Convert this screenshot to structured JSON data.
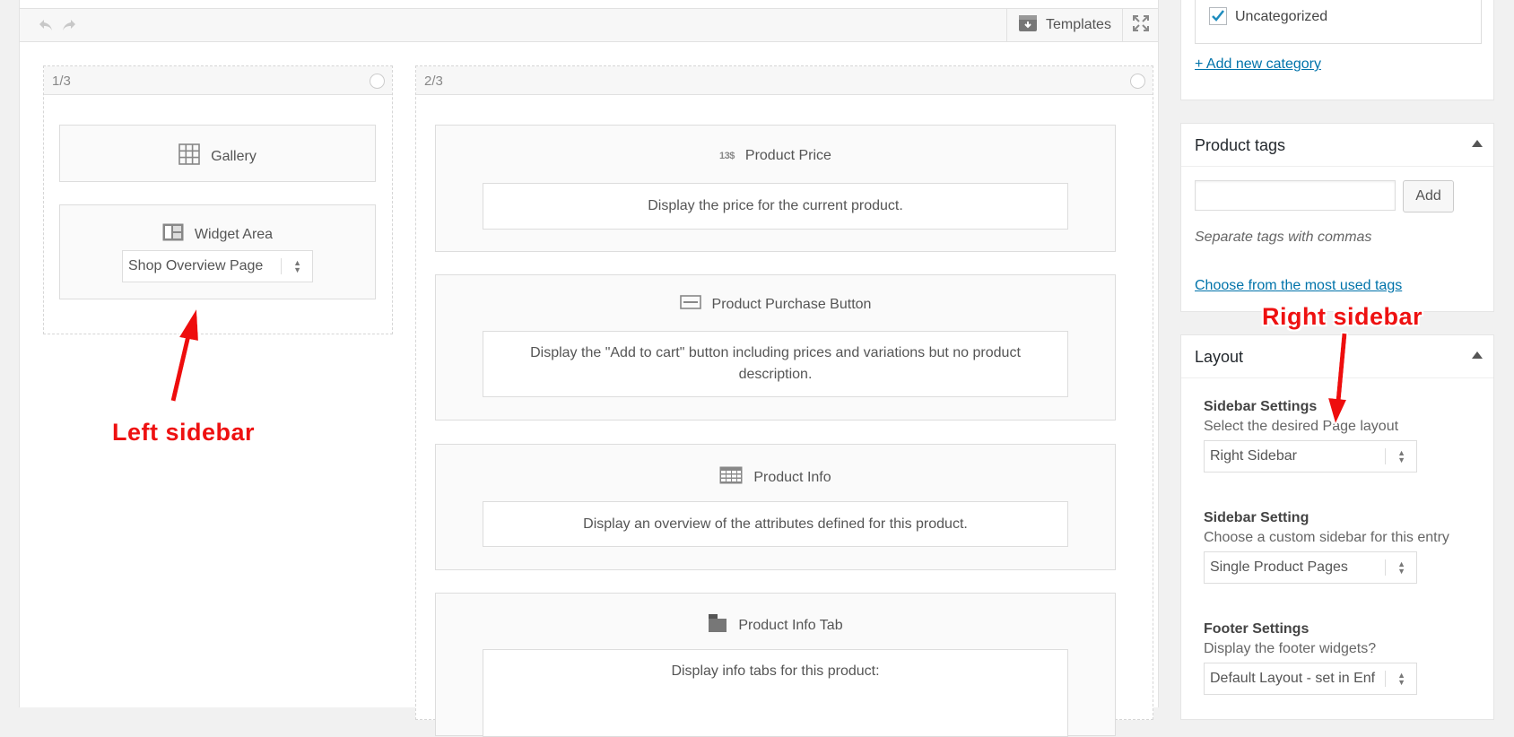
{
  "builder": {
    "toolbar": {
      "undo_icon": "undo-icon",
      "redo_icon": "redo-icon",
      "templates_label": "Templates",
      "templates_icon": "template-box-icon",
      "fullscreen_icon": "fullscreen-icon"
    },
    "left_column": {
      "label": "1/3",
      "elements": [
        {
          "title": "Gallery",
          "icon": "grid-icon"
        },
        {
          "title": "Widget Area",
          "icon": "widget-layout-icon",
          "select_value": "Shop Overview Page"
        }
      ]
    },
    "right_column": {
      "label": "2/3",
      "elements": [
        {
          "title": "Product Price",
          "icon": "price-icon",
          "icon_text": "13$",
          "description": "Display the price for the current product."
        },
        {
          "title": "Product Purchase Button",
          "icon": "button-icon",
          "description": "Display the \"Add to cart\" button including prices and variations but no product description."
        },
        {
          "title": "Product Info",
          "icon": "table-icon",
          "description": "Display an overview of the attributes defined for this product."
        },
        {
          "title": "Product Info Tab",
          "icon": "folder-tab-icon",
          "description": "Display info tabs for this product:"
        }
      ]
    }
  },
  "sidebar": {
    "categories": {
      "checked_label": "Uncategorized",
      "checked": true,
      "add_new_link": "+ Add new category"
    },
    "tags": {
      "title": "Product tags",
      "input_value": "",
      "add_button": "Add",
      "hint": "Separate tags with commas",
      "choose_link": "Choose from the most used tags"
    },
    "layout": {
      "title": "Layout",
      "fields": [
        {
          "title": "Sidebar Settings",
          "desc": "Select the desired Page layout",
          "value": "Right Sidebar"
        },
        {
          "title": "Sidebar Setting",
          "desc": "Choose a custom sidebar for this entry",
          "value": "Single Product Pages"
        },
        {
          "title": "Footer Settings",
          "desc": "Display the footer widgets?",
          "value": "Default Layout - set in Enf"
        }
      ]
    }
  },
  "annotations": {
    "left": "Left sidebar",
    "right": "Right sidebar",
    "color": "#ee1111"
  }
}
